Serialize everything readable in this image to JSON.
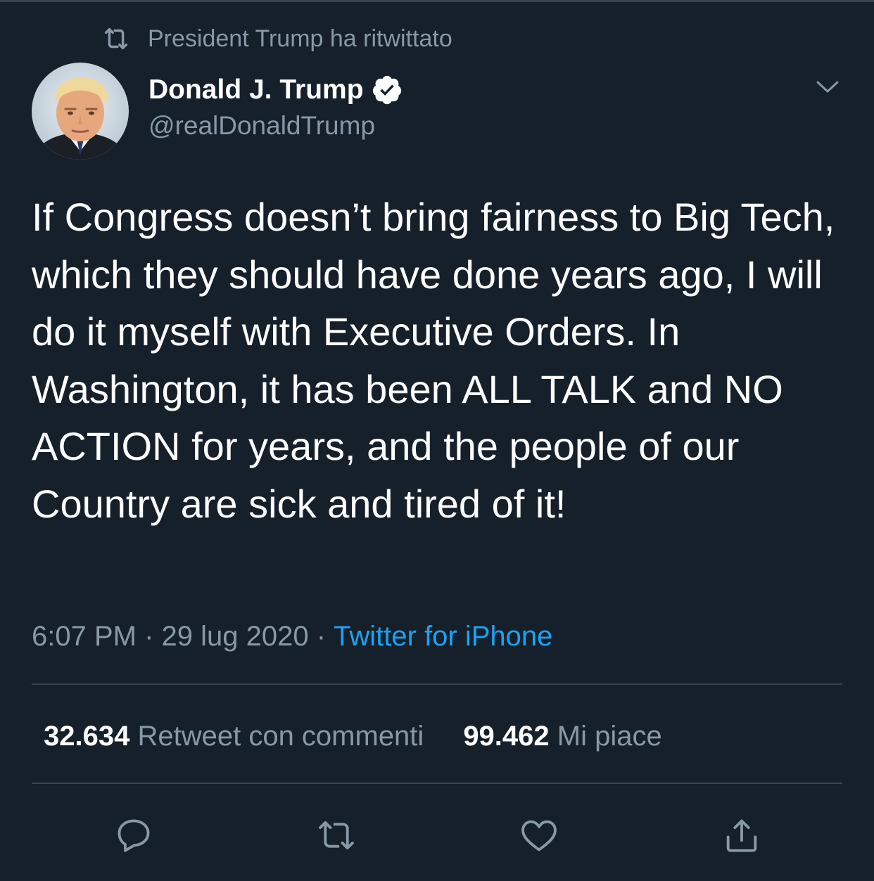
{
  "retweet_context": {
    "icon": "retweet-icon",
    "text": "President Trump ha ritwittato"
  },
  "author": {
    "display_name": "Donald J. Trump",
    "verified_icon": "verified-badge-icon",
    "handle": "@realDonaldTrump",
    "avatar": "profile-photo"
  },
  "menu_icon": "chevron-down-icon",
  "tweet": {
    "text": "If Congress doesn’t bring fairness to Big Tech, which they should have done years ago, I will do it myself with Executive Orders. In Washington, it has been ALL TALK and NO ACTION for years, and the people of our Country are sick and tired of it!"
  },
  "meta": {
    "time": "6:07 PM",
    "separator": " · ",
    "date": "29 lug 2020",
    "source": "Twitter for iPhone"
  },
  "stats": {
    "quote_count": "32.634",
    "quote_label": "Retweet con commenti",
    "like_count": "99.462",
    "like_label": "Mi piace"
  },
  "actions": [
    {
      "icon": "reply-icon"
    },
    {
      "icon": "retweet-icon"
    },
    {
      "icon": "like-heart-icon"
    },
    {
      "icon": "share-icon"
    }
  ],
  "colors": {
    "background": "#15202b",
    "secondary_text": "#8899a6",
    "accent": "#1da1f2",
    "divider": "#38444d"
  }
}
